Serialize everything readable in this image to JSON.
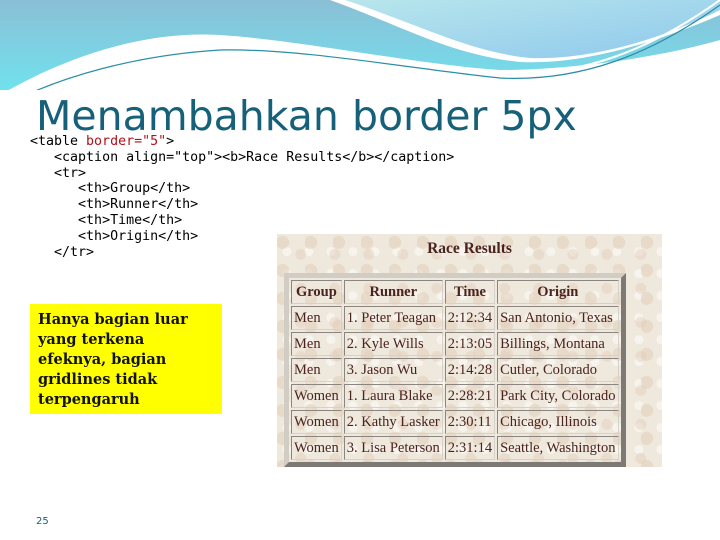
{
  "slide": {
    "title": "Menambahkan border 5px",
    "page_number": "25",
    "note": "Hanya bagian luar yang terkena efeknya, bagian gridlines tidak terpengaruh"
  },
  "code": {
    "lines": [
      {
        "indent": "",
        "pre": "<table ",
        "attr": "border=\"5\"",
        "post": ">"
      },
      {
        "indent": "   ",
        "pre": "<caption align=\"top\"><b>Race Results</b></caption>",
        "attr": "",
        "post": ""
      },
      {
        "indent": "   ",
        "pre": "<tr>",
        "attr": "",
        "post": ""
      },
      {
        "indent": "      ",
        "pre": "<th>Group</th>",
        "attr": "",
        "post": ""
      },
      {
        "indent": "      ",
        "pre": "<th>Runner</th>",
        "attr": "",
        "post": ""
      },
      {
        "indent": "      ",
        "pre": "<th>Time</th>",
        "attr": "",
        "post": ""
      },
      {
        "indent": "      ",
        "pre": "<th>Origin</th>",
        "attr": "",
        "post": ""
      },
      {
        "indent": "   ",
        "pre": "</tr>",
        "attr": "",
        "post": ""
      }
    ]
  },
  "race_table": {
    "caption": "Race Results",
    "headers": [
      "Group",
      "Runner",
      "Time",
      "Origin"
    ],
    "rows": [
      [
        "Men",
        "1. Peter Teagan",
        "2:12:34",
        "San Antonio, Texas"
      ],
      [
        "Men",
        "2. Kyle Wills",
        "2:13:05",
        "Billings, Montana"
      ],
      [
        "Men",
        "3. Jason Wu",
        "2:14:28",
        "Cutler, Colorado"
      ],
      [
        "Women",
        "1. Laura Blake",
        "2:28:21",
        "Park City, Colorado"
      ],
      [
        "Women",
        "2. Kathy Lasker",
        "2:30:11",
        "Chicago, Illinois"
      ],
      [
        "Women",
        "3. Lisa Peterson",
        "2:31:14",
        "Seattle, Washington"
      ]
    ]
  },
  "colors": {
    "title": "#17607a",
    "note_background": "#ffff00",
    "code_attribute": "#b0101a",
    "table_text": "#4a2320"
  }
}
